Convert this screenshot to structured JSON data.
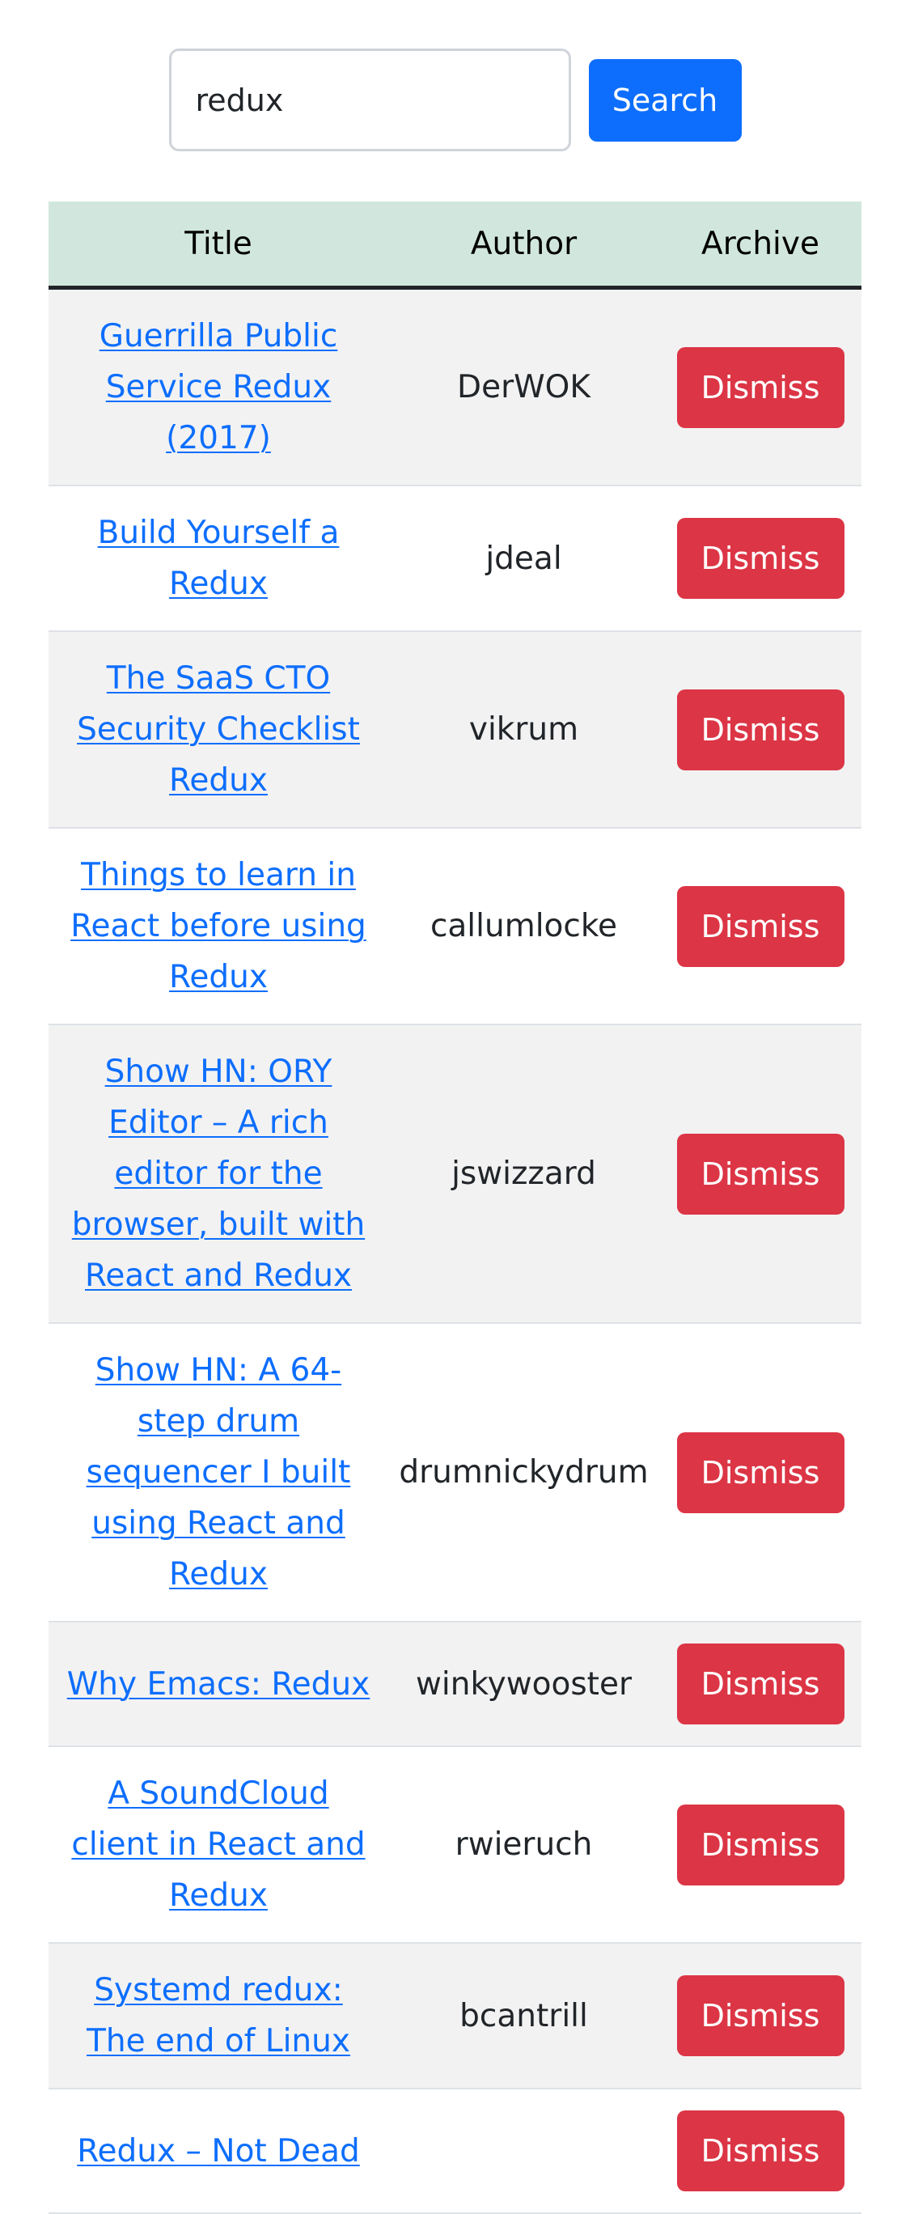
{
  "search": {
    "value": "redux",
    "button_label": "Search"
  },
  "table": {
    "headers": {
      "title": "Title",
      "author": "Author",
      "archive": "Archive"
    },
    "dismiss_label": "Dismiss",
    "rows": [
      {
        "title": "Guerrilla Public Service Redux (2017)",
        "author": "DerWOK"
      },
      {
        "title": "Build Yourself a Redux",
        "author": "jdeal"
      },
      {
        "title": "The SaaS CTO Security Checklist Redux",
        "author": "vikrum"
      },
      {
        "title": "Things to learn in React before using Redux",
        "author": "callumlocke"
      },
      {
        "title": "Show HN: ORY Editor – A rich editor for the browser, built with React and Redux",
        "author": "jswizzard"
      },
      {
        "title": "Show HN: A 64-step drum sequencer I built using React and Redux",
        "author": "drumnickydrum"
      },
      {
        "title": "Why Emacs: Redux",
        "author": "winkywooster"
      },
      {
        "title": "A SoundCloud client in React and Redux",
        "author": "rwieruch"
      },
      {
        "title": "Systemd redux: The end of Linux",
        "author": "bcantrill"
      },
      {
        "title": "Redux – Not Dead",
        "author": ""
      }
    ]
  },
  "colors": {
    "primary": "#0d6efd",
    "danger": "#dc3545",
    "header_bg": "#d1e7dd",
    "stripe_bg": "#f2f2f2"
  }
}
